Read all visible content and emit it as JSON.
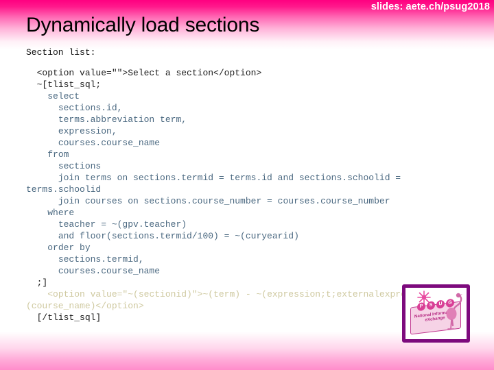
{
  "slide": {
    "header_link": "slides: aete.ch/psug2018",
    "title": "Dynamically load sections",
    "label": "Section list:",
    "colors": {
      "gradient_top": "#ff0080",
      "gradient_bottom": "#ff8dcb",
      "title_text": "#000000",
      "header_link_text": "#ffffff",
      "code_dark": "#1a1a1a",
      "code_sql": "#4a6880",
      "code_template": "#cfc9a0",
      "logo_border": "#7d0a7d"
    }
  },
  "code": {
    "lines": [
      {
        "text": "  <option value=\"\">Select a section</option>",
        "style": "dark"
      },
      {
        "text": "  ~[tlist_sql;",
        "style": "dark"
      },
      {
        "text": "    select",
        "style": "sql"
      },
      {
        "text": "      sections.id,",
        "style": "sql"
      },
      {
        "text": "      terms.abbreviation term,",
        "style": "sql"
      },
      {
        "text": "      expression,",
        "style": "sql"
      },
      {
        "text": "      courses.course_name",
        "style": "sql"
      },
      {
        "text": "    from",
        "style": "sql"
      },
      {
        "text": "      sections",
        "style": "sql"
      },
      {
        "text": "      join terms on sections.termid = terms.id and sections.schoolid = terms.schoolid",
        "style": "sql"
      },
      {
        "text": "      join courses on sections.course_number = courses.course_number",
        "style": "sql"
      },
      {
        "text": "    where",
        "style": "sql"
      },
      {
        "text": "      teacher = ~(gpv.teacher)",
        "style": "sql"
      },
      {
        "text": "      and floor(sections.termid/100) = ~(curyearid)",
        "style": "sql"
      },
      {
        "text": "    order by",
        "style": "sql"
      },
      {
        "text": "      sections.termid,",
        "style": "sql"
      },
      {
        "text": "      courses.course_name",
        "style": "sql"
      },
      {
        "text": "  ;]",
        "style": "dark"
      },
      {
        "text": "    <option value=\"~(sectionid)\">~(term) - ~(expression;t;externalexpression)  ~(course_name)</option>",
        "style": "tmpl"
      },
      {
        "text": "  [/tlist_sql]",
        "style": "dark"
      }
    ]
  },
  "logo": {
    "name": "psug-nix-logo",
    "letters": [
      "P",
      "S",
      "U",
      "G"
    ],
    "caption_line1": "National Information",
    "caption_line2": "eXchange"
  }
}
